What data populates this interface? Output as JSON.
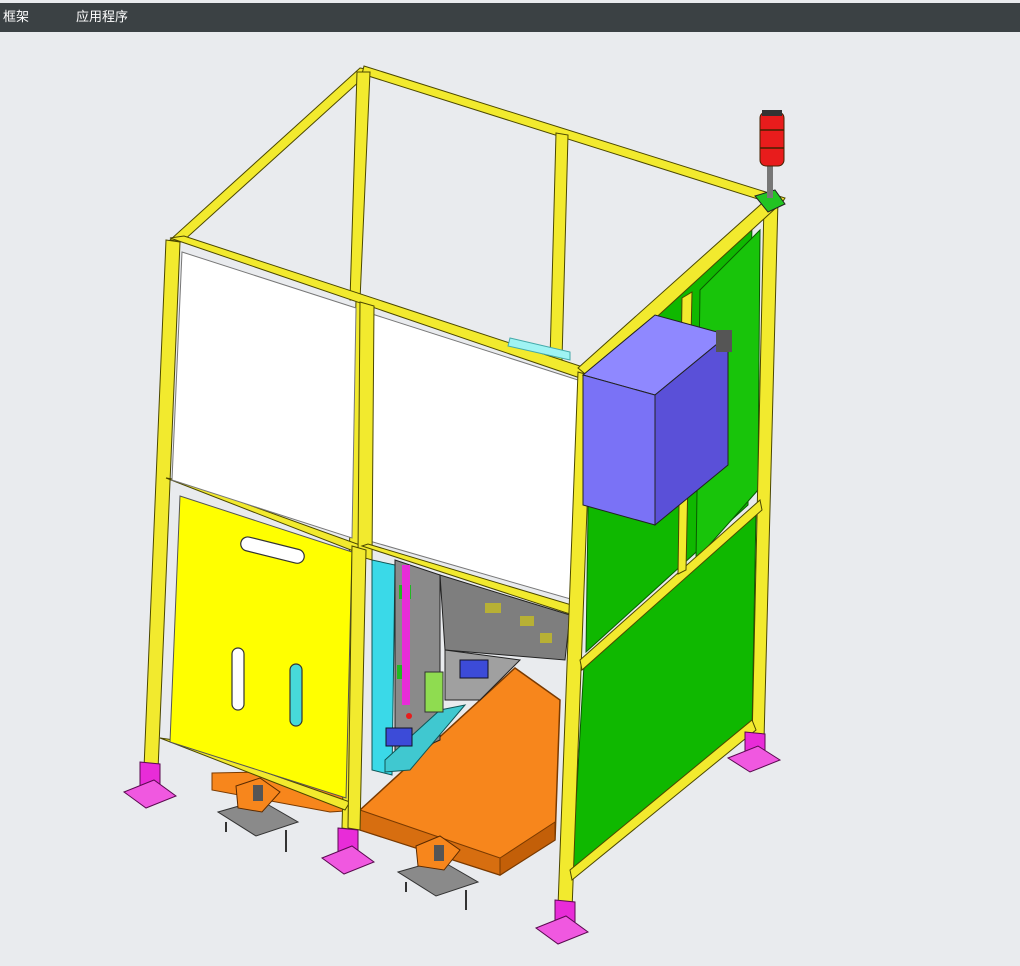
{
  "menubar": {
    "items": [
      {
        "label": "框架"
      },
      {
        "label": "应用程序"
      }
    ]
  },
  "colors": {
    "menubar_bg": "#3b4144",
    "viewport_bg": "#e9ebee",
    "frame_yellow": "#f2ea2e",
    "panel_green": "#0fb800",
    "panel_yellow": "#ffff00",
    "base_orange": "#f7861c",
    "feet_magenta": "#e82cd8",
    "control_box_blue": "#7a72f6",
    "signal_light_red": "#e81c1c"
  },
  "viewport": {
    "model_icon": "cad-enclosure-model"
  }
}
